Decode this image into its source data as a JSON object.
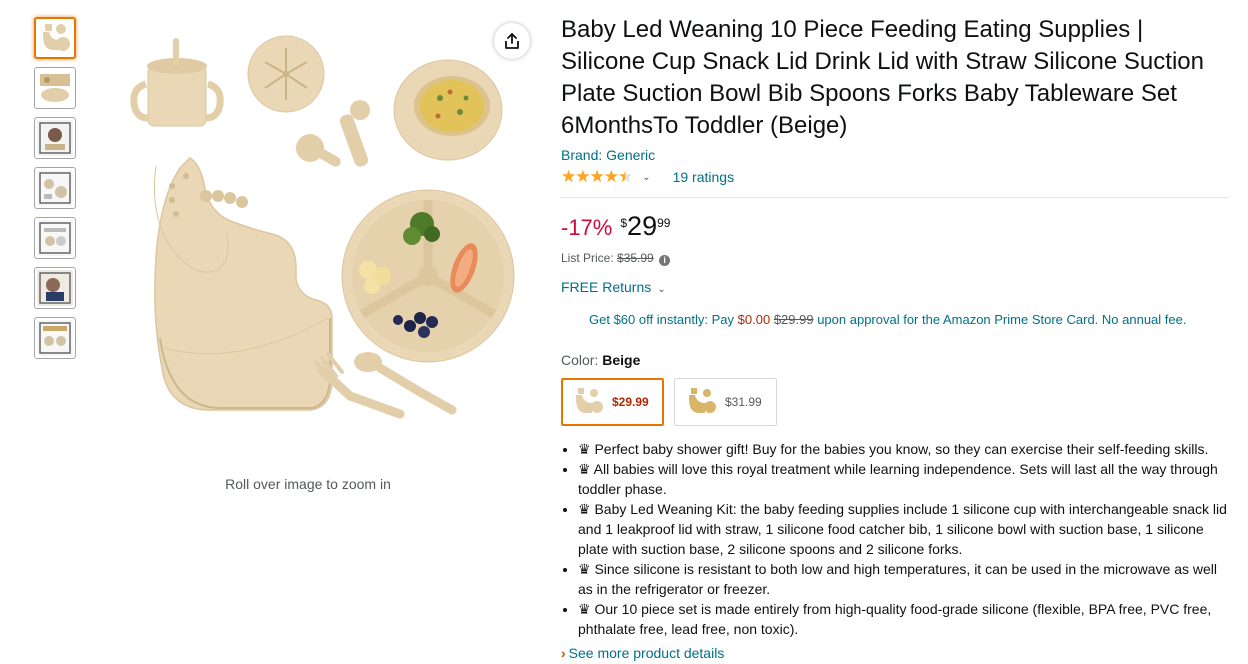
{
  "thumbnails": [
    {
      "name": "thumb-1",
      "selected": true
    },
    {
      "name": "thumb-2",
      "selected": false
    },
    {
      "name": "thumb-3",
      "selected": false
    },
    {
      "name": "thumb-4",
      "selected": false
    },
    {
      "name": "thumb-5",
      "selected": false
    },
    {
      "name": "thumb-6",
      "selected": false
    },
    {
      "name": "thumb-7",
      "selected": false
    }
  ],
  "gallery": {
    "zoom_hint": "Roll over image to zoom in",
    "share_icon": "share-icon"
  },
  "product": {
    "title": "Baby Led Weaning 10 Piece Feeding Eating Supplies | Silicone Cup Snack Lid Drink Lid with Straw Silicone Suction Plate Suction Bowl Bib Spoons Forks Baby Tableware Set 6MonthsTo Toddler (Beige)",
    "brand": "Brand: Generic",
    "stars": "★★★★★",
    "rating_value": 4.5,
    "ratings_count": "19 ratings",
    "discount": "-17%",
    "price_symbol": "$",
    "price_whole": "29",
    "price_fraction": "99",
    "list_price_label": "List Price:",
    "list_price": "$35.99",
    "returns": "FREE Returns",
    "promo": {
      "prefix": "Get $60 off instantly: Pay",
      "pay": "$0.00",
      "was": "$29.99",
      "suffix": "upon approval for the Amazon Prime Store Card. No annual fee."
    },
    "color_label": "Color:",
    "color_value": "Beige",
    "swatches": [
      {
        "price": "$29.99",
        "selected": true
      },
      {
        "price": "$31.99",
        "selected": false
      }
    ],
    "bullets": [
      "♛ Perfect baby shower gift! Buy for the babies you know, so they can exercise their self-feeding skills.",
      "♛ All babies will love this royal treatment while learning independence. Sets will last all the way through toddler phase.",
      "♛ Baby Led Weaning Kit: the baby feeding supplies include 1 silicone cup with interchangeable snack lid and 1 leakproof lid with straw, 1 silicone food catcher bib, 1 silicone bowl with suction base, 1 silicone plate with suction base, 2 silicone spoons and 2 silicone forks.",
      "♛ Since silicone is resistant to both low and high temperatures, it can be used in the microwave as well as in the refrigerator or freezer.",
      "♛ Our 10 piece set is made entirely from high-quality food-grade silicone (flexible, BPA free, PVC free, phthalate free, lead free, non toxic)."
    ],
    "see_more": "See more product details"
  },
  "colors": {
    "accent_orange": "#e77600",
    "link_teal": "#007185",
    "deal_red": "#cc0c39",
    "price_red": "#b12704",
    "star_orange": "#ffa41c",
    "product_beige": "#e9d7b5"
  }
}
